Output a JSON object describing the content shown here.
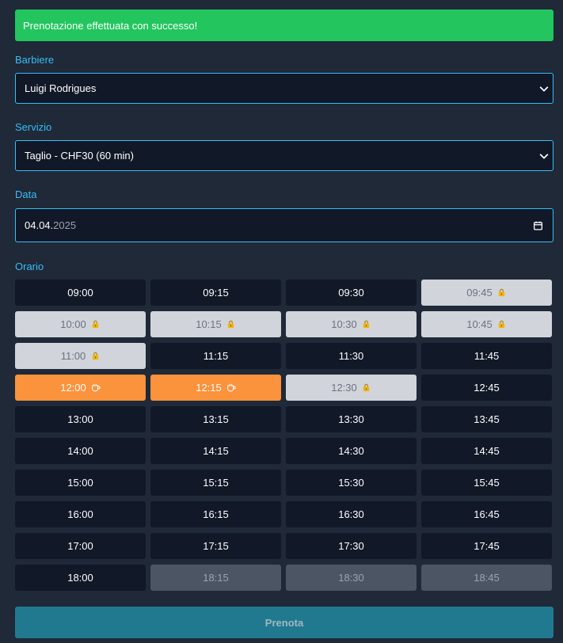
{
  "alert": {
    "text": "Prenotazione effettuata con successo!",
    "color": "#22c55e"
  },
  "barber": {
    "label": "Barbiere",
    "value": "Luigi Rodrigues",
    "icon": "chevron-down-icon"
  },
  "service": {
    "label": "Servizio",
    "value": "Taglio - CHF30 (60 min)",
    "icon": "chevron-down-icon"
  },
  "date": {
    "label": "Data",
    "day_month": "04.04.",
    "year": "2025",
    "icon": "calendar-icon"
  },
  "time": {
    "label": "Orario",
    "slots": [
      {
        "time": "09:00",
        "status": "available"
      },
      {
        "time": "09:15",
        "status": "available"
      },
      {
        "time": "09:30",
        "status": "available"
      },
      {
        "time": "09:45",
        "status": "booked",
        "icon": "lock-icon"
      },
      {
        "time": "10:00",
        "status": "booked",
        "icon": "lock-icon"
      },
      {
        "time": "10:15",
        "status": "booked",
        "icon": "lock-icon"
      },
      {
        "time": "10:30",
        "status": "booked",
        "icon": "lock-icon"
      },
      {
        "time": "10:45",
        "status": "booked",
        "icon": "lock-icon"
      },
      {
        "time": "11:00",
        "status": "booked",
        "icon": "lock-icon"
      },
      {
        "time": "11:15",
        "status": "available"
      },
      {
        "time": "11:30",
        "status": "available"
      },
      {
        "time": "11:45",
        "status": "available"
      },
      {
        "time": "12:00",
        "status": "break",
        "icon": "coffee-icon"
      },
      {
        "time": "12:15",
        "status": "break",
        "icon": "coffee-icon"
      },
      {
        "time": "12:30",
        "status": "booked",
        "icon": "lock-icon"
      },
      {
        "time": "12:45",
        "status": "available"
      },
      {
        "time": "13:00",
        "status": "available"
      },
      {
        "time": "13:15",
        "status": "available"
      },
      {
        "time": "13:30",
        "status": "available"
      },
      {
        "time": "13:45",
        "status": "available"
      },
      {
        "time": "14:00",
        "status": "available"
      },
      {
        "time": "14:15",
        "status": "available"
      },
      {
        "time": "14:30",
        "status": "available"
      },
      {
        "time": "14:45",
        "status": "available"
      },
      {
        "time": "15:00",
        "status": "available"
      },
      {
        "time": "15:15",
        "status": "available"
      },
      {
        "time": "15:30",
        "status": "available"
      },
      {
        "time": "15:45",
        "status": "available"
      },
      {
        "time": "16:00",
        "status": "available"
      },
      {
        "time": "16:15",
        "status": "available"
      },
      {
        "time": "16:30",
        "status": "available"
      },
      {
        "time": "16:45",
        "status": "available"
      },
      {
        "time": "17:00",
        "status": "available"
      },
      {
        "time": "17:15",
        "status": "available"
      },
      {
        "time": "17:30",
        "status": "available"
      },
      {
        "time": "17:45",
        "status": "available"
      },
      {
        "time": "18:00",
        "status": "available"
      },
      {
        "time": "18:15",
        "status": "closed"
      },
      {
        "time": "18:30",
        "status": "closed"
      },
      {
        "time": "18:45",
        "status": "closed"
      }
    ]
  },
  "submit": {
    "label": "Prenota",
    "color": "#21798f"
  },
  "colors": {
    "background": "#1f2937",
    "accent": "#38bdf8",
    "slot_available": "#111827",
    "slot_booked": "#d1d5db",
    "slot_break": "#fb923c",
    "slot_closed": "#4b5563"
  }
}
